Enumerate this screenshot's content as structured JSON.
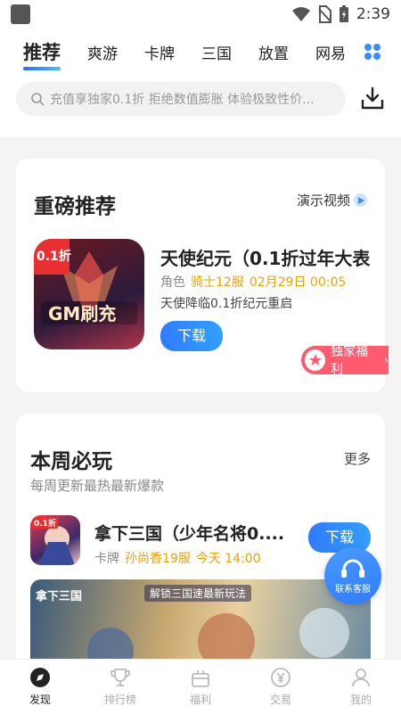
{
  "status": {
    "time": "2:39"
  },
  "tabs": [
    "推荐",
    "爽游",
    "卡牌",
    "三国",
    "放置",
    "网易"
  ],
  "search": {
    "placeholder": "充值享独家0.1折 拒绝数值膨胀 体验极致性价..."
  },
  "featured": {
    "title": "重磅推荐",
    "demo_label": "演示视频",
    "game": {
      "name": "天使纪元（0.1折过年大表",
      "genre": "角色",
      "server": "骑士12服",
      "date": "02月29日 00:05",
      "desc": "天使降临0.1折纪元重启",
      "button": "下载",
      "image_text": "GM刷充",
      "badge": "0.1折"
    },
    "welfare_label": "独家福利"
  },
  "weekly": {
    "title": "本周必玩",
    "more": "更多",
    "subtitle": "每周更新最热最新爆款",
    "game": {
      "name": "拿下三国（少年名将0....",
      "genre": "卡牌",
      "server": "孙尚香19服",
      "date": "今天 14:00",
      "button": "下载",
      "badge": "0.1折"
    },
    "banner_text": "解锁三国速最新玩法",
    "banner_logo": "拿下三国"
  },
  "customer_service": {
    "label": "联系客服"
  },
  "bottom_nav": [
    {
      "label": "发现",
      "icon": "compass-icon",
      "active": true
    },
    {
      "label": "排行榜",
      "icon": "trophy-icon",
      "active": false
    },
    {
      "label": "福利",
      "icon": "gift-icon",
      "active": false
    },
    {
      "label": "交易",
      "icon": "yen-exchange-icon",
      "active": false
    },
    {
      "label": "我的",
      "icon": "user-icon",
      "active": false
    }
  ]
}
